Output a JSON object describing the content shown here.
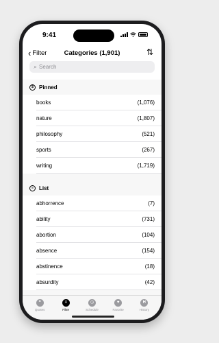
{
  "status_bar": {
    "time": "9:41"
  },
  "nav": {
    "back_label": "Filter",
    "title": "Categories (1,901)"
  },
  "search": {
    "placeholder": "Search",
    "value": ""
  },
  "sections": {
    "pinned": {
      "title": "Pinned",
      "items": [
        {
          "label": "books",
          "count": "(1,076)"
        },
        {
          "label": "nature",
          "count": "(1,807)"
        },
        {
          "label": "philosophy",
          "count": "(521)"
        },
        {
          "label": "sports",
          "count": "(267)"
        },
        {
          "label": "writing",
          "count": "(1,719)"
        }
      ]
    },
    "list": {
      "title": "List",
      "items": [
        {
          "label": "abhorrence",
          "count": "(7)"
        },
        {
          "label": "ability",
          "count": "(731)"
        },
        {
          "label": "abortion",
          "count": "(104)"
        },
        {
          "label": "absence",
          "count": "(154)"
        },
        {
          "label": "abstinence",
          "count": "(18)"
        },
        {
          "label": "absurdity",
          "count": "(42)"
        }
      ]
    }
  },
  "tabbar": {
    "items": [
      {
        "label": "Quotes",
        "icon": "quote-icon",
        "active": false
      },
      {
        "label": "Filter",
        "icon": "filter-icon",
        "active": true
      },
      {
        "label": "Schedule",
        "icon": "clock-icon",
        "active": false
      },
      {
        "label": "Favorite",
        "icon": "heart-icon",
        "active": false
      },
      {
        "label": "History",
        "icon": "history-icon",
        "active": false
      }
    ]
  }
}
